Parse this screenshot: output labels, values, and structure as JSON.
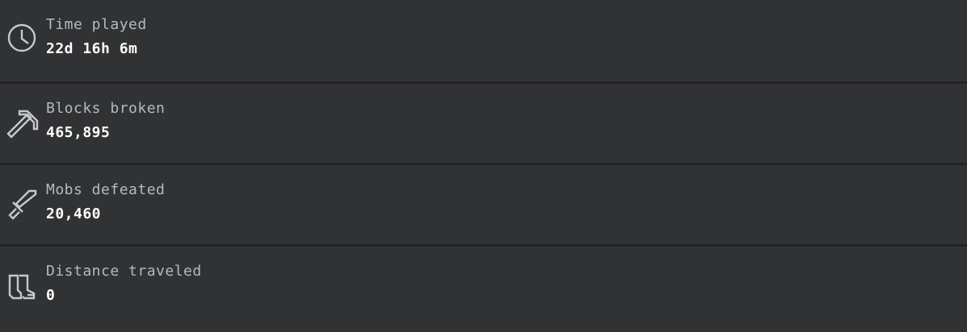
{
  "stats": [
    {
      "icon": "clock-icon",
      "label": "Time played",
      "value": "22d 16h 6m"
    },
    {
      "icon": "pickaxe-icon",
      "label": "Blocks broken",
      "value": "465,895"
    },
    {
      "icon": "sword-icon",
      "label": "Mobs defeated",
      "value": "20,460"
    },
    {
      "icon": "boots-icon",
      "label": "Distance traveled",
      "value": "0"
    }
  ],
  "colors": {
    "background": "#313234",
    "divider": "#232325",
    "label": "#b9b9bb",
    "value": "#ffffff"
  }
}
